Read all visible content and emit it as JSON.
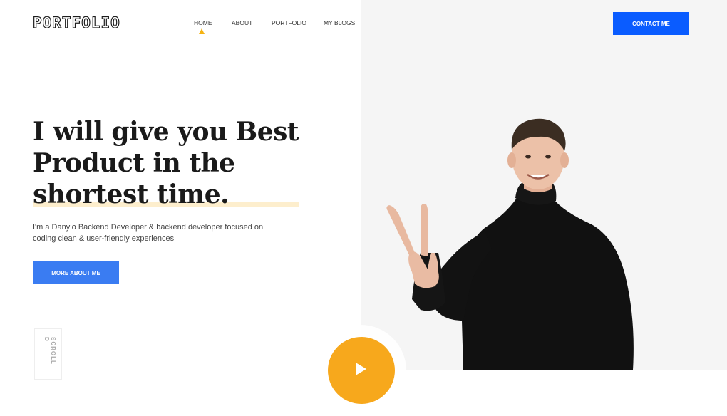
{
  "header": {
    "logo": "PORTFOLIO",
    "nav": [
      {
        "label": "HOME",
        "active": true
      },
      {
        "label": "ABOUT"
      },
      {
        "label": "PORTFOLIO"
      },
      {
        "label": "MY BLOGS"
      }
    ],
    "contact_label": "CONTACT ME"
  },
  "hero": {
    "title_lines": [
      "I will give you Best",
      "Product in the",
      "shortest time."
    ],
    "description": "I'm a Danylo Backend Developer & backend developer focused on coding clean & user-friendly experiences",
    "cta_label": "MORE ABOUT ME",
    "scroll_label": "SCROLL D"
  },
  "colors": {
    "accent_blue": "#0a5cff",
    "button_blue": "#3a7cf2",
    "accent_yellow": "#f5b313",
    "play_orange": "#f7a81c",
    "underline": "#fdeecd"
  },
  "icons": {
    "nav_indicator": "triangle-up-icon",
    "play": "play-icon"
  }
}
